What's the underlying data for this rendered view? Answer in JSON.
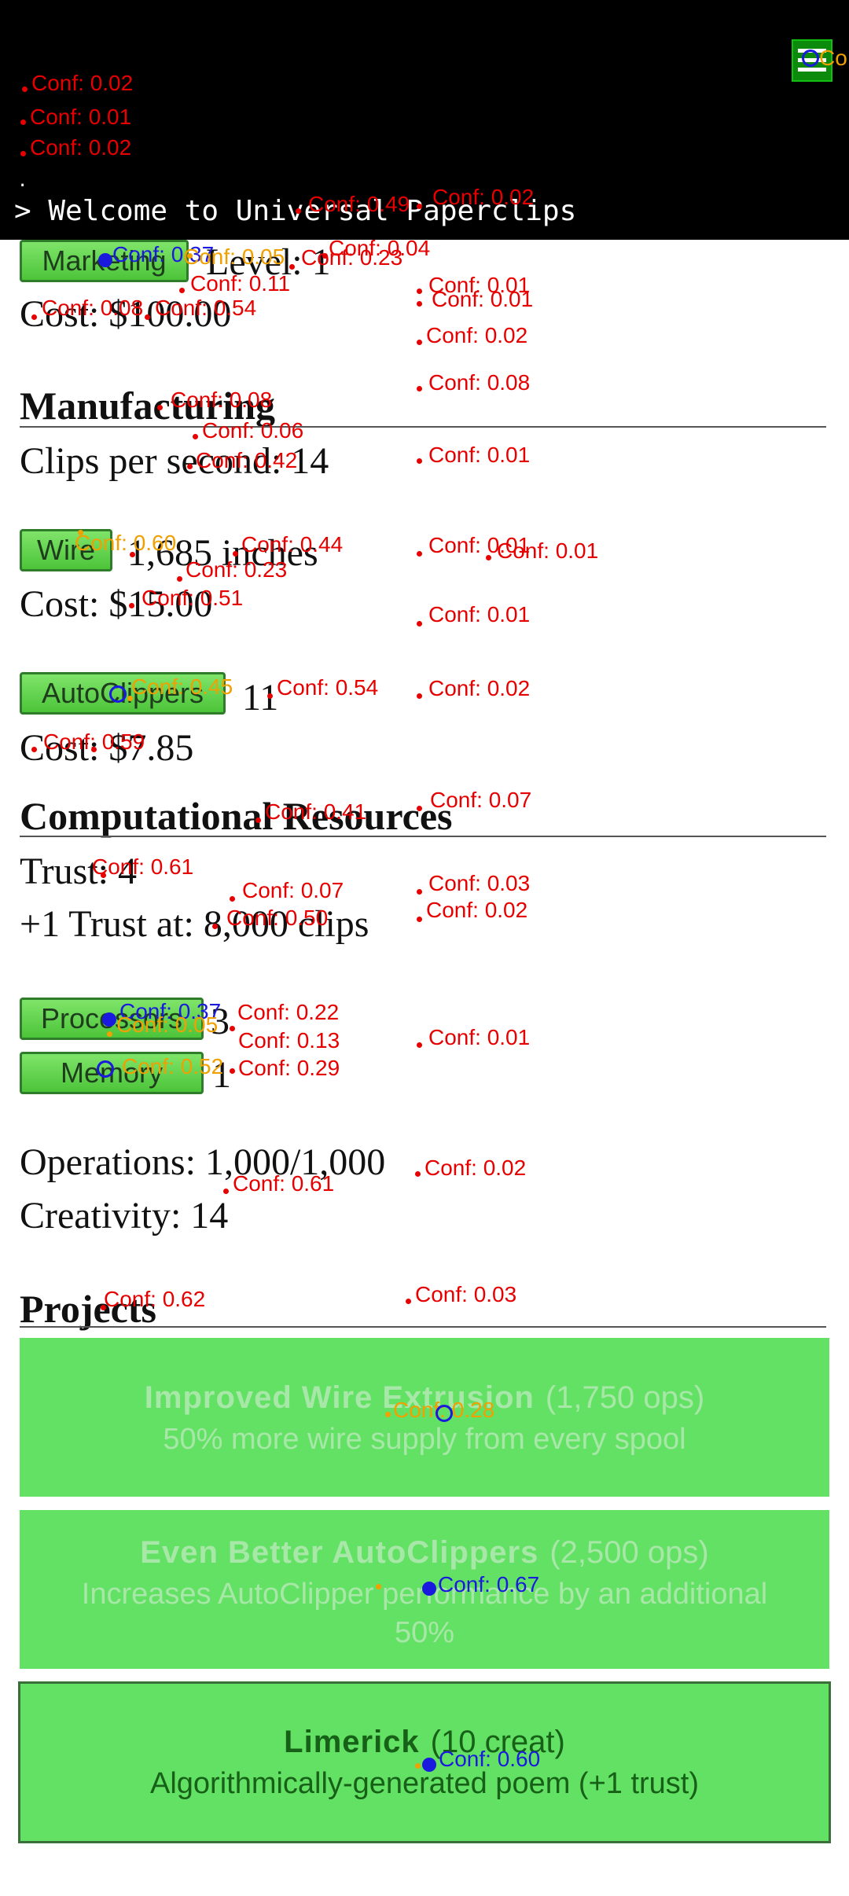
{
  "console": {
    "dot": ".",
    "welcome": "> Welcome to Universal Paperclips"
  },
  "business": {
    "marketing_button": "Marketing",
    "marketing_level": "Level: 1",
    "marketing_cost": "Cost: $100.00"
  },
  "manufacturing": {
    "heading": "Manufacturing",
    "clips_per_second": "Clips per second: 14",
    "wire_button": "Wire",
    "wire_inches": "1,685 inches",
    "wire_cost": "Cost: $15.00",
    "autoclippers_button": "AutoClippers",
    "autoclippers_count": "11",
    "autoclippers_cost": "Cost: $7.85"
  },
  "computational": {
    "heading": "Computational Resources",
    "trust": "Trust: 4",
    "next_trust": "+1 Trust at: 8,000 clips",
    "processors_button": "Processors",
    "processors_count": "3",
    "memory_button": "Memory",
    "memory_count": "1",
    "operations": "Operations: 1,000/1,000",
    "creativity": "Creativity: 14"
  },
  "projects": {
    "heading": "Projects",
    "items": [
      {
        "title": "Improved Wire Extrusion",
        "cost": "(1,750 ops)",
        "desc": "50% more wire supply from every spool"
      },
      {
        "title": "Even Better AutoClippers",
        "cost": "(2,500 ops)",
        "desc": "Increases AutoClipper performance by an additional 50%"
      },
      {
        "title": "Limerick",
        "cost": "(10 creat)",
        "desc": "Algorithmically-generated poem (+1 trust)"
      }
    ]
  },
  "colors": {
    "console_bg": "#000000",
    "button_green": "#5ccc48",
    "project_green": "#63e164",
    "detection_red": "#e60000",
    "detection_orange": "#f0a000",
    "detection_blue": "#1a1adf"
  },
  "detections": [
    {
      "id": "d1",
      "label": "Conf: 0.02"
    },
    {
      "id": "d2",
      "label": "Conf: 0.01"
    },
    {
      "id": "d3",
      "label": "Conf: 0.02"
    },
    {
      "id": "d4",
      "label": "Conf: 0.49"
    },
    {
      "id": "d5",
      "label": "Conf: 0.02"
    },
    {
      "id": "d6",
      "label": "Conf: 0.04"
    },
    {
      "id": "d7",
      "label": "Conf: 0.23"
    },
    {
      "id": "d8",
      "label": "Conf: 0.37"
    },
    {
      "id": "d9",
      "label": "Conf: 0.05"
    },
    {
      "id": "d10",
      "label": "Conf: 0.11"
    },
    {
      "id": "d11",
      "label": "Conf: 0.01"
    },
    {
      "id": "d12",
      "label": "Conf: 0.01"
    },
    {
      "id": "d13",
      "label": "Conf: 0.08"
    },
    {
      "id": "d14",
      "label": "Conf: 0.54"
    },
    {
      "id": "d15",
      "label": "Conf: 0.02"
    },
    {
      "id": "d16",
      "label": "Conf: 0.08"
    },
    {
      "id": "d17",
      "label": "Conf: 0.08"
    },
    {
      "id": "d18",
      "label": "Conf: 0.06"
    },
    {
      "id": "d19",
      "label": "Conf: 0.42"
    },
    {
      "id": "d20",
      "label": "Conf: 0.01"
    },
    {
      "id": "d21",
      "label": "Conf: 0.60"
    },
    {
      "id": "d22",
      "label": "Conf: 0.44"
    },
    {
      "id": "d23",
      "label": "Conf: 0.23"
    },
    {
      "id": "d24",
      "label": "Conf: 0.01"
    },
    {
      "id": "d25",
      "label": "Conf: 0.01"
    },
    {
      "id": "d26",
      "label": "Conf: 0.51"
    },
    {
      "id": "d27",
      "label": "Conf: 0.01"
    },
    {
      "id": "d28",
      "label": "Conf: 0.45"
    },
    {
      "id": "d29",
      "label": "Conf: 0.54"
    },
    {
      "id": "d30",
      "label": "Conf: 0.02"
    },
    {
      "id": "d31",
      "label": "Conf: 0.59"
    },
    {
      "id": "d32",
      "label": "Conf: 0.41"
    },
    {
      "id": "d33",
      "label": "Conf: 0.07"
    },
    {
      "id": "d34",
      "label": "Conf: 0.61"
    },
    {
      "id": "d35",
      "label": "Conf: 0.07"
    },
    {
      "id": "d36",
      "label": "Conf: 0.03"
    },
    {
      "id": "d37",
      "label": "Conf: 0.50"
    },
    {
      "id": "d38",
      "label": "Conf: 0.02"
    },
    {
      "id": "d39",
      "label": "Conf: 0.37"
    },
    {
      "id": "d40",
      "label": "Conf: 0.22"
    },
    {
      "id": "d41",
      "label": "Conf: 0.05"
    },
    {
      "id": "d42",
      "label": "Conf: 0.13"
    },
    {
      "id": "d43",
      "label": "Conf: 0.01"
    },
    {
      "id": "d44",
      "label": "Conf: 0.52"
    },
    {
      "id": "d45",
      "label": "Conf: 0.29"
    },
    {
      "id": "d46",
      "label": "Conf: 0.02"
    },
    {
      "id": "d47",
      "label": "Conf: 0.61"
    },
    {
      "id": "d48",
      "label": "Conf: 0.62"
    },
    {
      "id": "d49",
      "label": "Conf: 0.03"
    },
    {
      "id": "d50",
      "label": "Conf: 0.28"
    },
    {
      "id": "d51",
      "label": "Conf: 0.67"
    },
    {
      "id": "d52",
      "label": "Conf: 0.60"
    },
    {
      "id": "d53",
      "label": "Co"
    }
  ]
}
